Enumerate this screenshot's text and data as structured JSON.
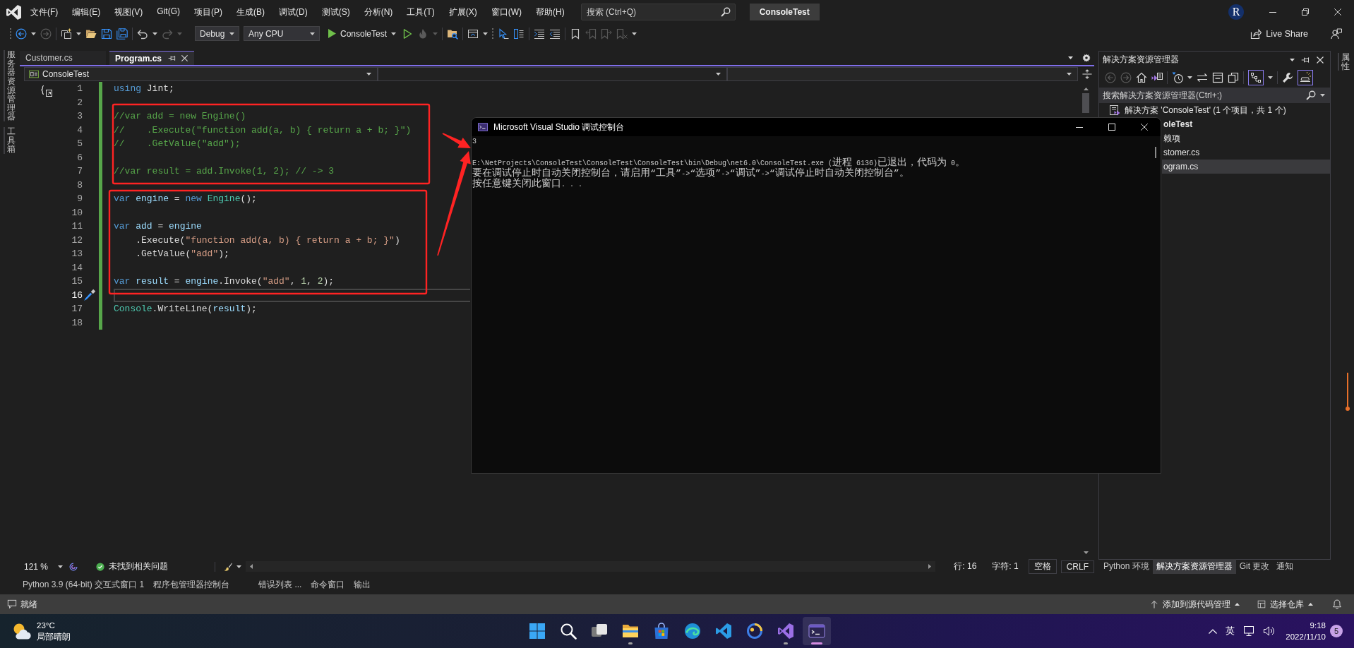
{
  "titlebar": {
    "menu": [
      "文件(F)",
      "编辑(E)",
      "视图(V)",
      "Git(G)",
      "项目(P)",
      "生成(B)",
      "调试(D)",
      "测试(S)",
      "分析(N)",
      "工具(T)",
      "扩展(X)",
      "窗口(W)",
      "帮助(H)"
    ],
    "search": {
      "placeholder": "搜索 (Ctrl+Q)"
    },
    "solution_name": "ConsoleTest",
    "avatar": "R"
  },
  "toolbar": {
    "configuration": "Debug",
    "platform": "Any CPU",
    "start_target": "ConsoleTest",
    "live_share": "Live Share"
  },
  "left_strip": {
    "tabs": [
      "服务器资源管理器",
      "工具箱"
    ]
  },
  "editor": {
    "tabs": [
      {
        "label": "Customer.cs",
        "selected": false
      },
      {
        "label": "Program.cs",
        "selected": true
      }
    ],
    "nav": {
      "project": "ConsoleTest"
    },
    "changes_saved": true,
    "lines": [
      {
        "number": "1",
        "current": false,
        "tokens": [
          {
            "kind": "keyword",
            "text": "using"
          },
          {
            "kind": "plain",
            "text": " Jint;"
          }
        ]
      },
      {
        "number": "2",
        "current": false
      },
      {
        "number": "3",
        "current": false,
        "tokens": [
          {
            "kind": "comment",
            "text": "//var add = new Engine()"
          }
        ]
      },
      {
        "number": "4",
        "current": false,
        "tokens": [
          {
            "kind": "comment",
            "text": "//    .Execute(\"function add(a, b) { return a + b; }\")"
          }
        ]
      },
      {
        "number": "5",
        "current": false,
        "tokens": [
          {
            "kind": "comment",
            "text": "//    .GetValue(\"add\");"
          }
        ]
      },
      {
        "number": "6",
        "current": false
      },
      {
        "number": "7",
        "current": false,
        "tokens": [
          {
            "kind": "comment",
            "text": "//var result = add.Invoke(1, 2); // -> 3"
          }
        ]
      },
      {
        "number": "8",
        "current": false
      },
      {
        "number": "9",
        "current": false,
        "tokens": [
          {
            "kind": "keyword",
            "text": "var"
          },
          {
            "kind": "variable",
            "text": " engine"
          },
          {
            "kind": "plain",
            "text": " = "
          },
          {
            "kind": "keyword",
            "text": "new"
          },
          {
            "kind": "type",
            "text": " Engine"
          },
          {
            "kind": "plain",
            "text": "();"
          }
        ]
      },
      {
        "number": "10",
        "current": false
      },
      {
        "number": "11",
        "current": false,
        "tokens": [
          {
            "kind": "keyword",
            "text": "var"
          },
          {
            "kind": "variable",
            "text": " add"
          },
          {
            "kind": "plain",
            "text": " = "
          },
          {
            "kind": "variable",
            "text": "engine"
          }
        ]
      },
      {
        "number": "12",
        "current": false,
        "tokens": [
          {
            "kind": "plain",
            "text": "    .Execute("
          },
          {
            "kind": "string",
            "text": "\"function add(a, b) { return a + b; }\""
          },
          {
            "kind": "plain",
            "text": ")"
          }
        ]
      },
      {
        "number": "13",
        "current": false,
        "tokens": [
          {
            "kind": "plain",
            "text": "    .GetValue("
          },
          {
            "kind": "string",
            "text": "\"add\""
          },
          {
            "kind": "plain",
            "text": ");"
          }
        ]
      },
      {
        "number": "14",
        "current": false
      },
      {
        "number": "15",
        "current": false,
        "tokens": [
          {
            "kind": "keyword",
            "text": "var"
          },
          {
            "kind": "variable",
            "text": " result"
          },
          {
            "kind": "plain",
            "text": " = "
          },
          {
            "kind": "variable",
            "text": "engine"
          },
          {
            "kind": "plain",
            "text": ".Invoke("
          },
          {
            "kind": "string",
            "text": "\"add\""
          },
          {
            "kind": "plain",
            "text": ", "
          },
          {
            "kind": "number",
            "text": "1"
          },
          {
            "kind": "plain",
            "text": ", "
          },
          {
            "kind": "number",
            "text": "2"
          },
          {
            "kind": "plain",
            "text": ");"
          }
        ]
      },
      {
        "number": "16",
        "current": true
      },
      {
        "number": "17",
        "current": false,
        "tokens": [
          {
            "kind": "type",
            "text": "Console"
          },
          {
            "kind": "plain",
            "text": ".WriteLine("
          },
          {
            "kind": "variable",
            "text": "result"
          },
          {
            "kind": "plain",
            "text": ");"
          }
        ]
      },
      {
        "number": "18",
        "current": false
      }
    ],
    "zoom": "121 %",
    "issues": "未找到相关问题",
    "position": [
      {
        "label": "行: 16",
        "kind": "text"
      },
      {
        "label": "字符: 1",
        "kind": "text"
      },
      {
        "label": "空格",
        "kind": "button"
      },
      {
        "label": "CRLF",
        "kind": "button"
      }
    ]
  },
  "console": {
    "title": "Microsoft Visual Studio 调试控制台",
    "output": [
      "3"
    ],
    "messages": [
      "E:\\NetProjects\\ConsoleTest\\ConsoleTest\\ConsoleTest\\bin\\Debug\\net6.0\\ConsoleTest.exe (进程 6136)已退出，代码为 0。",
      "要在调试停止时自动关闭控制台，请启用“工具”->“选项”->“调试”->“调试停止时自动关闭控制台”。",
      "按任意键关闭此窗口. . ."
    ]
  },
  "solution_explorer": {
    "title": "解决方案资源管理器",
    "toggles": [
      {
        "kind": "tree",
        "on": true
      },
      {
        "kind": "preview",
        "on": true
      }
    ],
    "search": {
      "placeholder": "搜索解决方案资源管理器(Ctrl+;)"
    },
    "tree": [
      {
        "label": "解决方案 'ConsoleTest' (1 个项目，共 1 个)",
        "kind": "solution",
        "selected": false,
        "children": [
          {
            "label": "oleTest",
            "kind": "project",
            "selected": false,
            "children": [
              {
                "label": "赖项",
                "selected": false
              },
              {
                "label": "stomer.cs",
                "selected": false
              },
              {
                "label": "ogram.cs",
                "selected": true
              }
            ]
          }
        ]
      }
    ],
    "tabs": [
      {
        "label": "Python 环境",
        "selected": false
      },
      {
        "label": "解决方案资源管理器",
        "selected": true
      },
      {
        "label": "Git 更改",
        "selected": false
      },
      {
        "label": "通知",
        "selected": false
      }
    ]
  },
  "right_strip": {
    "tabs": [
      "属性"
    ]
  },
  "tool_tabs": [
    {
      "tabs": [
        "Python 3.9 (64-bit) 交互式窗口 1",
        "程序包管理器控制台"
      ]
    },
    {
      "tabs": [
        "错误列表 ...",
        "命令窗口",
        "输出"
      ]
    }
  ],
  "status_bar": {
    "status": "就绪",
    "source_control": "添加到源代码管理",
    "repository": "选择仓库"
  },
  "taskbar": {
    "weather": {
      "temperature": "23°C",
      "condition": "局部晴朗"
    },
    "apps": [
      {
        "kind": "start",
        "selected": false,
        "running": false
      },
      {
        "kind": "search",
        "selected": false,
        "running": false
      },
      {
        "kind": "taskview",
        "selected": false,
        "running": false
      },
      {
        "kind": "explorer",
        "selected": false,
        "running": true
      },
      {
        "kind": "store",
        "selected": false,
        "running": false
      },
      {
        "kind": "browser",
        "selected": false,
        "running": false
      },
      {
        "kind": "editor",
        "selected": false,
        "running": false
      },
      {
        "kind": "app",
        "selected": false,
        "running": false
      },
      {
        "kind": "ide",
        "selected": false,
        "running": true
      },
      {
        "kind": "terminal",
        "selected": true,
        "running": true
      }
    ],
    "input_language": "英",
    "time": "9:18",
    "date": "2022/11/10",
    "notifications": "5"
  }
}
